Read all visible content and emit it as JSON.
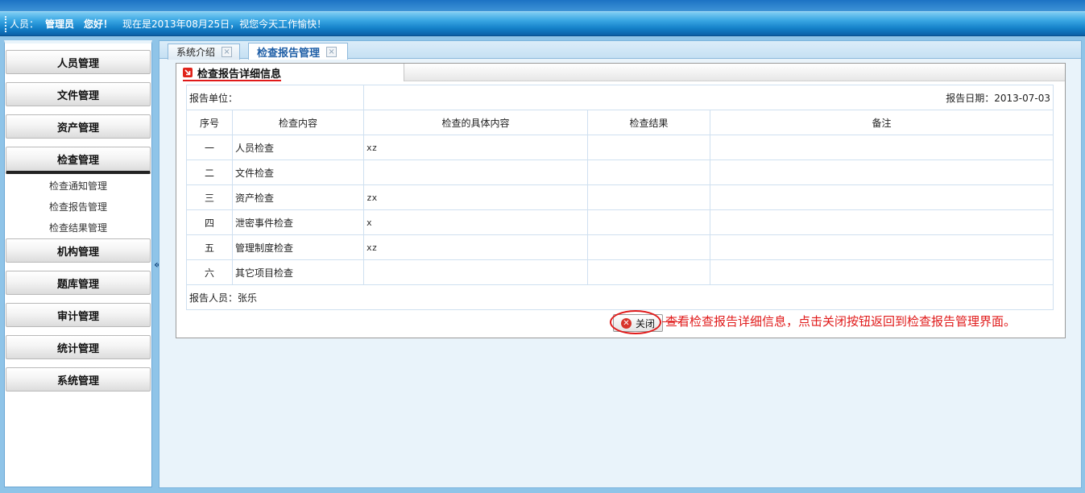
{
  "header": {
    "person_label": "人员：",
    "user_name": "管理员",
    "greeting": "您好！",
    "status_message": "现在是2013年08月25日，视您今天工作愉快！"
  },
  "sidebar": {
    "items": [
      {
        "label": "人员管理"
      },
      {
        "label": "文件管理"
      },
      {
        "label": "资产管理"
      },
      {
        "label": "检查管理"
      },
      {
        "label": "机构管理"
      },
      {
        "label": "题库管理"
      },
      {
        "label": "审计管理"
      },
      {
        "label": "统计管理"
      },
      {
        "label": "系统管理"
      }
    ],
    "sub_items": [
      {
        "label": "检查通知管理"
      },
      {
        "label": "检查报告管理"
      },
      {
        "label": "检查结果管理"
      }
    ],
    "collapse_glyph": "«"
  },
  "tabs": [
    {
      "label": "系统介绍",
      "close": "×"
    },
    {
      "label": "检查报告管理",
      "close": "×"
    }
  ],
  "panel": {
    "title": "检查报告详细信息"
  },
  "report": {
    "unit_label": "报告单位：",
    "unit_value": "",
    "date_label": "报告日期：",
    "date_value": "2013-07-03",
    "columns": [
      "序号",
      "检查内容",
      "检查的具体内容",
      "检查结果",
      "备注"
    ],
    "rows": [
      {
        "no": "一",
        "item": "人员检查",
        "detail": "xz",
        "result": "",
        "note": ""
      },
      {
        "no": "二",
        "item": "文件检查",
        "detail": "",
        "result": "",
        "note": ""
      },
      {
        "no": "三",
        "item": "资产检查",
        "detail": "zx",
        "result": "",
        "note": ""
      },
      {
        "no": "四",
        "item": "泄密事件检查",
        "detail": "x",
        "result": "",
        "note": ""
      },
      {
        "no": "五",
        "item": "管理制度检查",
        "detail": "xz",
        "result": "",
        "note": ""
      },
      {
        "no": "六",
        "item": "其它项目检查",
        "detail": "",
        "result": "",
        "note": ""
      }
    ],
    "reporter_label": "报告人员：",
    "reporter_value": "张乐"
  },
  "actions": {
    "close_label": "关闭"
  },
  "annotation": "查看检查报告详细信息，点击关闭按钮返回到检查报告管理界面。"
}
